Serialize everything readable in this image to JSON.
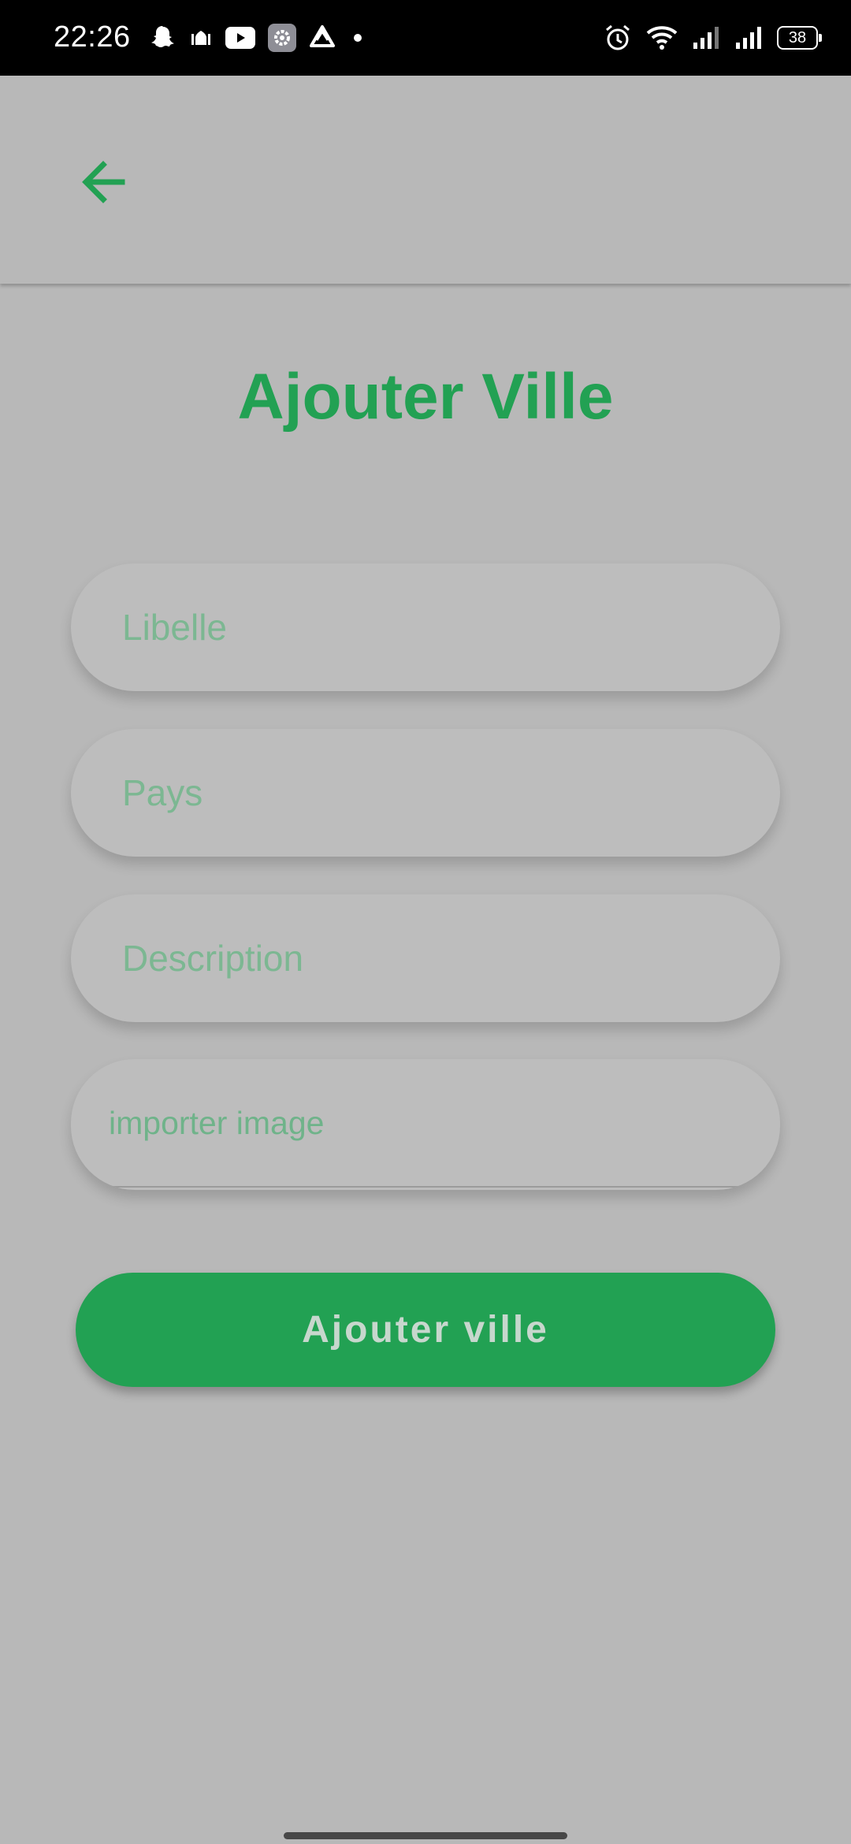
{
  "status_bar": {
    "time": "22:26",
    "battery": "38",
    "left_icons": [
      "snapchat-icon",
      "mosque-icon",
      "youtube-icon",
      "settings-app-icon",
      "dropbox-like-icon",
      "dot-icon"
    ],
    "right_icons": [
      "alarm-icon",
      "wifi-icon",
      "signal-icon",
      "signal-icon",
      "battery-icon"
    ]
  },
  "app_bar": {
    "back_icon": "arrow-left-icon"
  },
  "page": {
    "title": "Ajouter Ville"
  },
  "form": {
    "libelle_placeholder": "Libelle",
    "pays_placeholder": "Pays",
    "description_placeholder": "Description",
    "image_label": "importer image",
    "submit_label": "Ajouter ville"
  },
  "colors": {
    "accent": "#22a153",
    "background": "#b8b8b8",
    "field": "#bdbdbd",
    "status_bar": "#000000"
  }
}
